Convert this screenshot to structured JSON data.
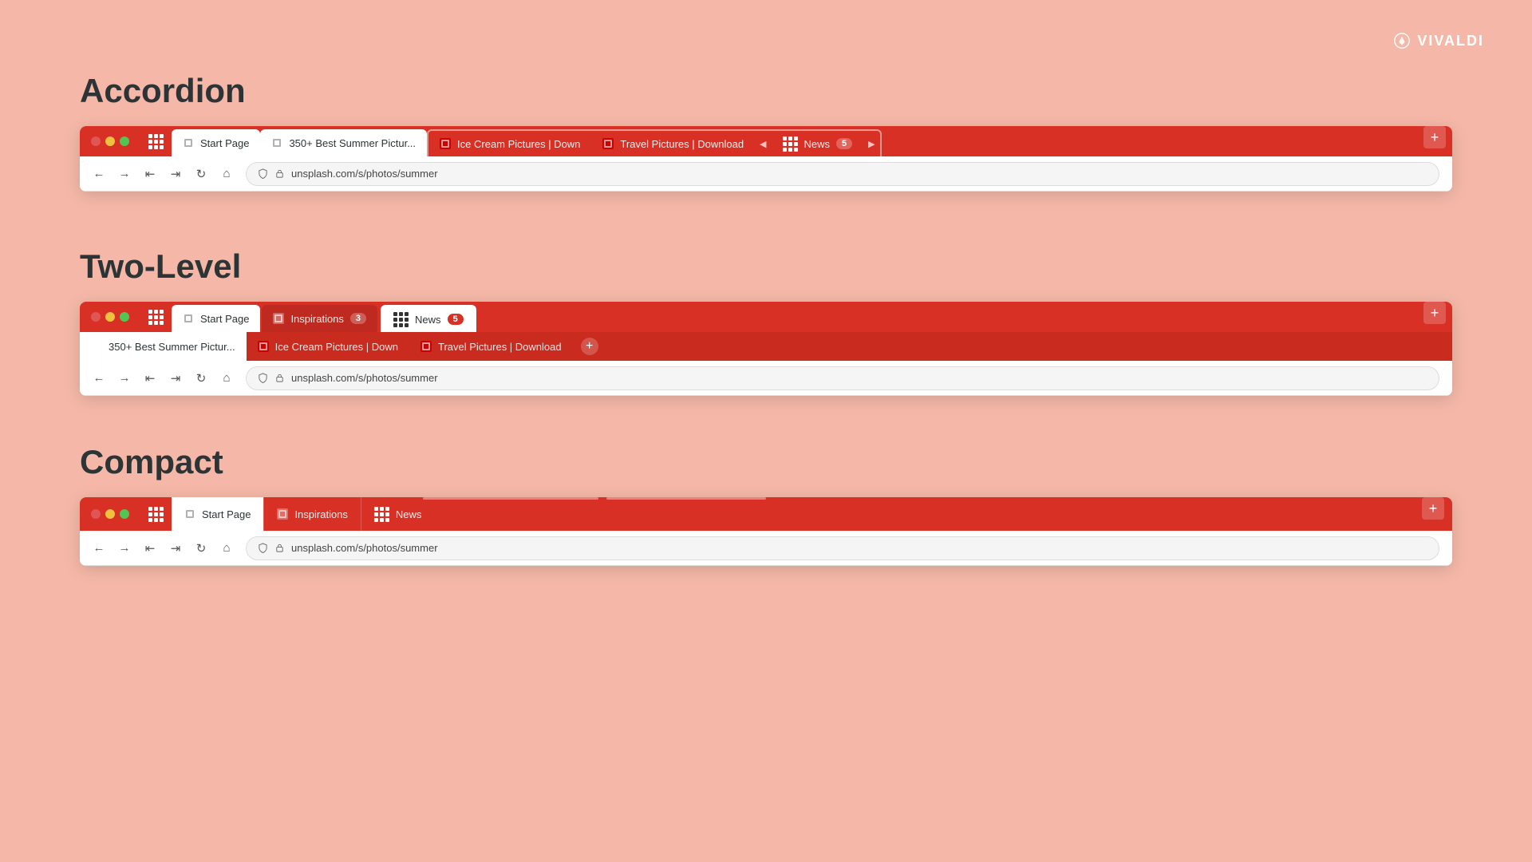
{
  "vivaldi": {
    "logo_text": "VIVALDI"
  },
  "page_bg": "#f5b8a8",
  "sections": {
    "accordion": {
      "heading": "Accordion",
      "browser": {
        "url": "unsplash.com/s/photos/summer",
        "tabs": [
          {
            "label": "Start Page",
            "type": "start",
            "active": false
          },
          {
            "label": "350+ Best Summer Pictur...",
            "type": "normal",
            "active": true
          },
          {
            "label": "Ice Cream Pictures | Down",
            "type": "stack",
            "active": false
          },
          {
            "label": "Travel Pictures | Download",
            "type": "stack",
            "active": false
          },
          {
            "label": "News",
            "type": "stack",
            "count": "5",
            "active": false
          }
        ]
      }
    },
    "two_level": {
      "heading": "Two-Level",
      "browser": {
        "url": "unsplash.com/s/photos/summer",
        "top_tabs": [
          {
            "label": "Start Page",
            "type": "start"
          },
          {
            "label": "Inspirations",
            "count": "3",
            "active": false
          },
          {
            "label": "News",
            "count": "5",
            "active": true
          }
        ],
        "sub_tabs": [
          {
            "label": "350+ Best Summer Pictur..."
          },
          {
            "label": "Ice Cream Pictures | Down"
          },
          {
            "label": "Travel Pictures | Download"
          }
        ]
      }
    },
    "compact": {
      "heading": "Compact",
      "browser": {
        "url": "unsplash.com/s/photos/summer",
        "tabs": [
          {
            "label": "Start Page",
            "type": "start"
          },
          {
            "label": "Inspirations",
            "type": "stack"
          },
          {
            "label": "News",
            "type": "stack"
          }
        ]
      }
    }
  },
  "buttons": {
    "add_tab": "+"
  }
}
